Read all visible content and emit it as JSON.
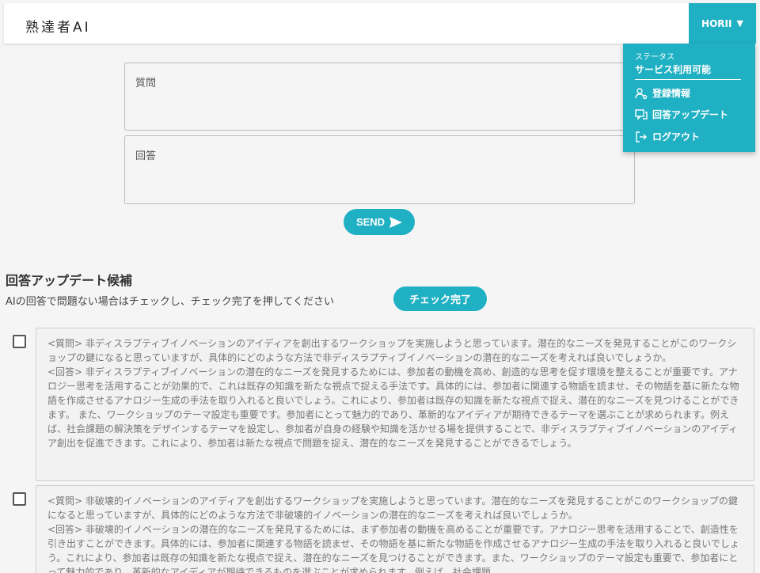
{
  "app": {
    "title": "熟達者AI"
  },
  "user": {
    "name": "HORII",
    "caret": "▼"
  },
  "menu": {
    "status_label": "ステータス",
    "status_value": "サービス利用可能",
    "items": [
      {
        "label": "登録情報",
        "icon": "user-settings-icon"
      },
      {
        "label": "回答アップデート",
        "icon": "chat-update-icon"
      },
      {
        "label": "ログアウト",
        "icon": "logout-icon"
      }
    ]
  },
  "form": {
    "question_placeholder": "質問",
    "answer_placeholder": "回答",
    "send_label": "SEND"
  },
  "candidates": {
    "title": "回答アップデート候補",
    "description": "AIの回答で問題ない場合はチェックし、チェック完了を押してください",
    "done_label": "チェック完了",
    "items": [
      {
        "question": "<質問> 非ディスラプティブイノベーションのアイディアを創出するワークショップを実施しようと思っています。潜在的なニーズを発見することがこのワークショップの鍵になると思っていますが、具体的にどのような方法で非ディスラプティブイノベーションの潜在的なニーズを考えれば良いでしょうか。",
        "answer": "<回答> 非ディスラプティブイノベーションの潜在的なニーズを発見するためには、参加者の動機を高め、創造的な思考を促す環境を整えることが重要です。アナロジー思考を活用することが効果的で、これは既存の知識を新たな視点で捉える手法です。具体的には、参加者に関連する物語を読ませ、その物語を基に新たな物語を作成させるアナロジー生成の手法を取り入れると良いでしょう。これにより、参加者は既存の知識を新たな視点で捉え、潜在的なニーズを見つけることができます。 また、ワークショップのテーマ設定も重要です。参加者にとって魅力的であり、革新的なアイディアが期待できるテーマを選ぶことが求められます。例えば、社会課題の解決策をデザインするテーマを設定し、参加者が自身の経験や知識を活かせる場を提供することで、非ディスラプティブイノベーションのアイディア創出を促進できます。これにより、参加者は新たな視点で問題を捉え、潜在的なニーズを発見することができるでしょう。"
      },
      {
        "question": "<質問> 非破壊的イノベーションのアイディアを創出するワークショップを実施しようと思っています。潜在的なニーズを発見することがこのワークショップの鍵になると思っていますが、具体的にどのような方法で非破壊的イノベーションの潜在的なニーズを考えれば良いでしょうか。",
        "answer": "<回答> 非破壊的イノベーションの潜在的なニーズを発見するためには、まず参加者の動機を高めることが重要です。アナロジー思考を活用することで、創造性を引き出すことができます。具体的には、参加者に関連する物語を読ませ、その物語を基に新たな物語を作成させるアナロジー生成の手法を取り入れると良いでしょう。これにより、参加者は既存の知識を新たな視点で捉え、潜在的なニーズを見つけることができます。また、ワークショップのテーマ設定も重要で、参加者にとって魅力的であり、革新的なアイディアが期待できるものを選ぶことが求められます。例えば、社会課題"
      }
    ]
  }
}
